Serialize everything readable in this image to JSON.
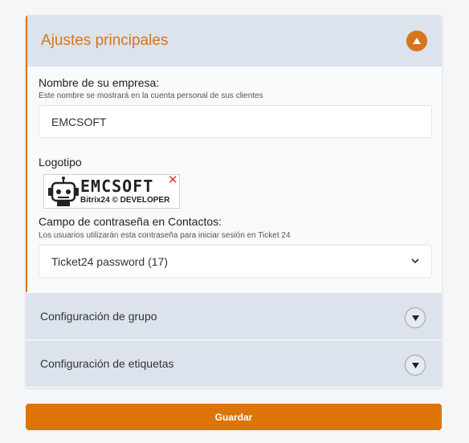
{
  "main_settings": {
    "title": "Ajustes principales",
    "company_name_label": "Nombre de su empresa:",
    "company_name_hint": "Este nombre se mostrará en la cuenta personal de sus clientes",
    "company_name_value": "EMCSOFT",
    "logo_label": "Logotipo",
    "logo": {
      "text": "EMCSOFT",
      "subtext": "Bitrix24 © DEVELOPER"
    },
    "password_field_label": "Campo de contraseña en Contactos:",
    "password_field_hint": "Los usuarios utilizarán esta contraseña para iniciar sesión en Ticket 24",
    "password_field_value": "Ticket24 password (17)"
  },
  "group_settings": {
    "title": "Configuración de grupo"
  },
  "tag_settings": {
    "title": "Configuración de etiquetas"
  },
  "save_button": {
    "label": "Guardar"
  },
  "colors": {
    "accent": "#d6751b",
    "header_bg": "#dde3ec",
    "button": "#dc7406"
  },
  "icons": {
    "expanded": "chevron-up-icon",
    "collapsed": "chevron-down-icon",
    "select": "select-chevron-icon",
    "logo_close": "close-icon"
  }
}
